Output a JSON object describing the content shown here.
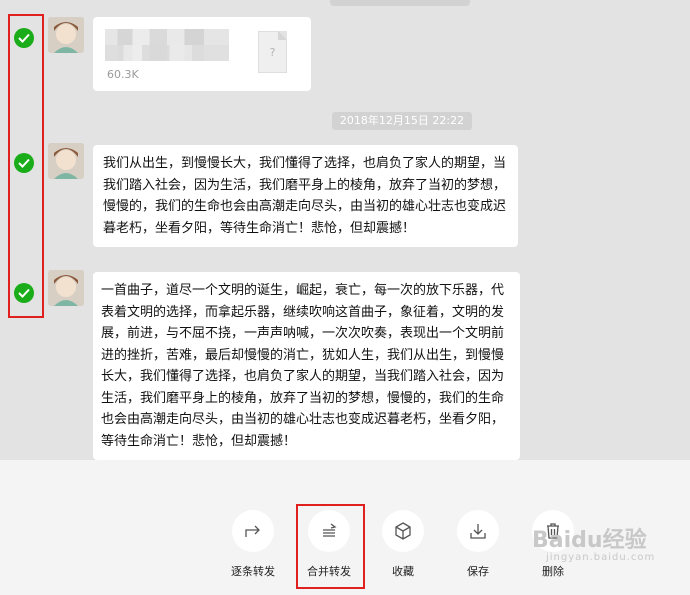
{
  "messages": {
    "file": {
      "size": "60.3K",
      "icon_glyph": "?"
    },
    "timestamp": "2018年12月15日 22:22",
    "msg1": "我们从出生，到慢慢长大，我们懂得了选择，也肩负了家人的期望，当我们踏入社会，因为生活，我们磨平身上的棱角，放弃了当初的梦想，慢慢的，我们的生命也会由高潮走向尽头，由当初的雄心壮志也变成迟暮老朽，坐看夕阳，等待生命消亡！悲怆，但却震撼！",
    "msg2": "一首曲子，道尽一个文明的诞生，崛起，衰亡，每一次的放下乐器，代表着文明的选择，而拿起乐器，继续吹响这首曲子，象征着，文明的发展，前进，与不屈不挠，一声声呐喊，一次次吹奏，表现出一个文明前进的挫折，苦难，最后却慢慢的消亡，犹如人生，我们从出生，到慢慢长大，我们懂得了选择，也肩负了家人的期望，当我们踏入社会，因为生活，我们磨平身上的棱角，放弃了当初的梦想，慢慢的，我们的生命也会由高潮走向尽头，由当初的雄心壮志也变成迟暮老朽，坐看夕阳，等待生命消亡！悲怆，但却震撼！"
  },
  "toolbar": {
    "forward_one_by_one": "逐条转发",
    "merge_forward": "合并转发",
    "favorite": "收藏",
    "save": "保存",
    "delete": "删除"
  },
  "watermark": {
    "brand": "Baidu经验",
    "sub": "jingyan.baidu.com"
  },
  "colors": {
    "check_green": "#1aad19",
    "highlight_red": "#e0201f"
  }
}
